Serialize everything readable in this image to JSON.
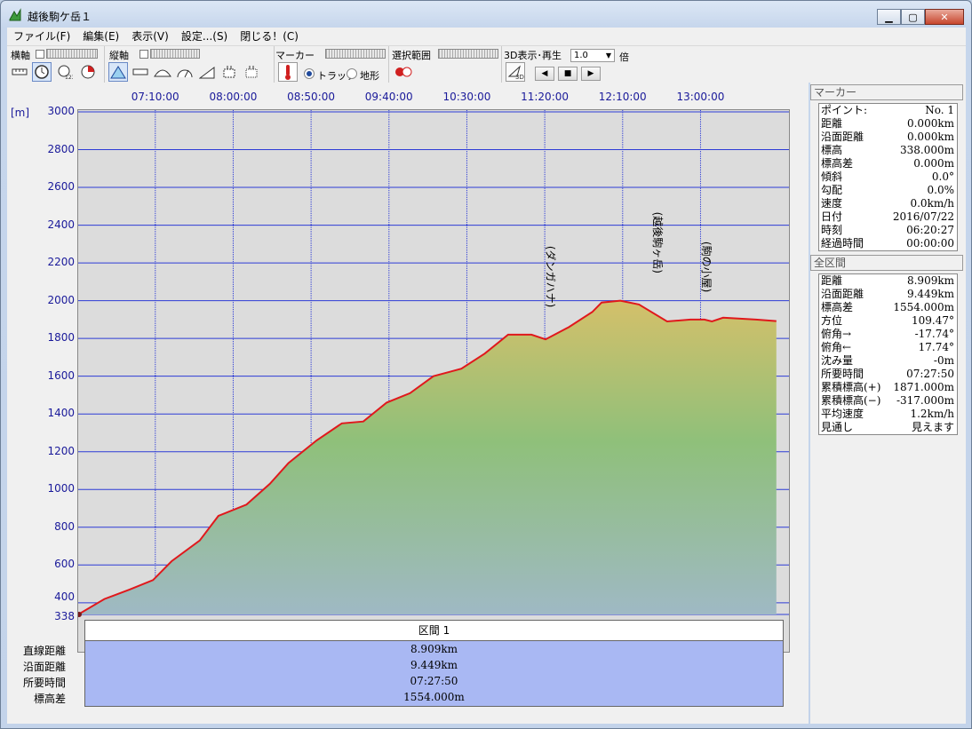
{
  "window": {
    "title": "越後駒ケ岳１"
  },
  "menu": [
    "ファイル(F)",
    "編集(E)",
    "表示(V)",
    "設定...(S)",
    "閉じる！(C)"
  ],
  "toolbar": {
    "h_axis_label": "横軸",
    "v_axis_label": "縦軸",
    "marker_label": "マーカー",
    "range_label": "選択範囲",
    "view3d_label": "3D表示･再生",
    "speed_value": "1.0",
    "speed_unit": "倍",
    "radio_track": "トラック",
    "radio_terrain": "地形",
    "btn_3d": "3D"
  },
  "chart_data": {
    "type": "area",
    "ylabel": "[m]",
    "ylim": [
      338,
      3000
    ],
    "yticks": [
      3000,
      2800,
      2600,
      2400,
      2200,
      2000,
      1800,
      1600,
      1400,
      1200,
      1000,
      800,
      600,
      400,
      338
    ],
    "xticks": [
      "07:10:00",
      "08:00:00",
      "08:50:00",
      "09:40:00",
      "10:30:00",
      "11:20:00",
      "12:10:00",
      "13:00:00"
    ],
    "x_hours": [
      0.0,
      0.28,
      0.55,
      0.8,
      1.0,
      1.3,
      1.5,
      1.8,
      2.05,
      2.25,
      2.55,
      2.82,
      3.05,
      3.3,
      3.55,
      3.8,
      4.1,
      4.35,
      4.6,
      4.85,
      5.0,
      5.25,
      5.5,
      5.6,
      5.8,
      6.0,
      6.3,
      6.55,
      6.7,
      6.78,
      6.9,
      7.25,
      7.47
    ],
    "elevation": [
      338,
      420,
      470,
      520,
      620,
      730,
      860,
      920,
      1030,
      1140,
      1260,
      1350,
      1360,
      1460,
      1510,
      1600,
      1640,
      1720,
      1820,
      1820,
      1795,
      1860,
      1940,
      1990,
      2000,
      1980,
      1890,
      1900,
      1900,
      1890,
      1910,
      1900,
      1892
    ],
    "start_time": "06:20:27",
    "annotations": [
      {
        "text": "(ダンガハナ)",
        "x_hour": 5.05,
        "elevation": 1820
      },
      {
        "text": "(越後駒ヶ岳)",
        "x_hour": 6.2,
        "elevation": 2000
      },
      {
        "text": "(駒の小屋)",
        "x_hour": 6.72,
        "elevation": 1900
      }
    ],
    "grid": true
  },
  "summary": {
    "header": "区間 1",
    "rows": [
      {
        "label": "直線距離",
        "value": "8.909km"
      },
      {
        "label": "沿面距離",
        "value": "9.449km"
      },
      {
        "label": "所要時間",
        "value": "07:27:50"
      },
      {
        "label": "標高差",
        "value": "1554.000m"
      }
    ]
  },
  "marker_panel": {
    "title": "マーカー",
    "rows": [
      {
        "label": "ポイント:",
        "value": "No. 1"
      },
      {
        "label": "距離",
        "value": "0.000km"
      },
      {
        "label": "沿面距離",
        "value": "0.000km"
      },
      {
        "label": "標高",
        "value": "338.000m"
      },
      {
        "label": "標高差",
        "value": "0.000m"
      },
      {
        "label": "傾斜",
        "value": "0.0°"
      },
      {
        "label": "勾配",
        "value": "0.0%"
      },
      {
        "label": "速度",
        "value": "0.0km/h"
      },
      {
        "label": "日付",
        "value": "2016/07/22"
      },
      {
        "label": "時刻",
        "value": "06:20:27"
      },
      {
        "label": "経過時間",
        "value": "00:00:00"
      }
    ]
  },
  "total_panel": {
    "title": "全区間",
    "rows": [
      {
        "label": "距離",
        "value": "8.909km"
      },
      {
        "label": "沿面距離",
        "value": "9.449km"
      },
      {
        "label": "標高差",
        "value": "1554.000m"
      },
      {
        "label": "方位",
        "value": "109.47°"
      },
      {
        "label": "俯角→",
        "value": "-17.74°"
      },
      {
        "label": "俯角←",
        "value": "17.74°"
      },
      {
        "label": "沈み量",
        "value": "-0m"
      },
      {
        "label": "所要時間",
        "value": "07:27:50"
      },
      {
        "label": "累積標高(+)",
        "value": "1871.000m"
      },
      {
        "label": "累積標高(−)",
        "value": "-317.000m"
      },
      {
        "label": "平均速度",
        "value": "1.2km/h"
      },
      {
        "label": "見通し",
        "value": "見えます"
      }
    ]
  },
  "colors": {
    "grid": "#2d3bd6",
    "track": "#e0181c",
    "fill_top": "#d4c06a",
    "fill_mid": "#8fc07a",
    "fill_bottom": "#9fb9c4"
  }
}
